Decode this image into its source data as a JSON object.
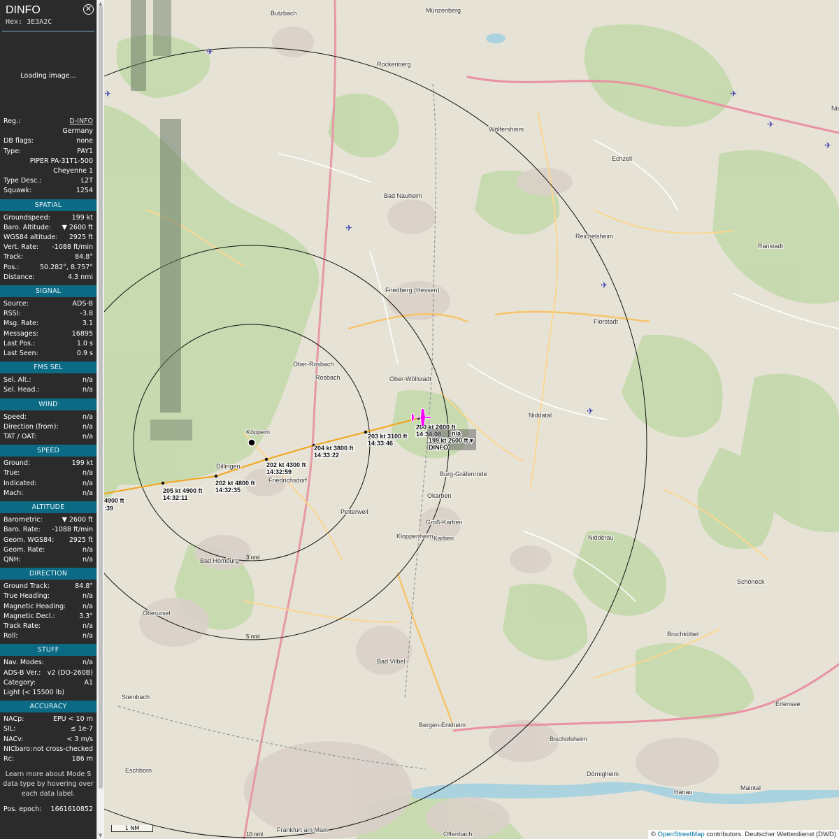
{
  "sidebar": {
    "callsign": "DINFO",
    "hex_label": "Hex:",
    "hex": "3E3A2C",
    "loading": "Loading image...",
    "general": [
      {
        "k": "Reg.:",
        "v": "D-INFO",
        "link": true
      },
      {
        "k": "",
        "v": "Germany"
      },
      {
        "k": "DB flags:",
        "v": "none"
      },
      {
        "k": "Type:",
        "v": "PAY1"
      },
      {
        "k": "",
        "v": "PIPER PA-31T1-500 Cheyenne 1"
      },
      {
        "k": "Type Desc.:",
        "v": "L2T"
      },
      {
        "k": "Squawk:",
        "v": "1254"
      }
    ],
    "sections": [
      {
        "title": "SPATIAL",
        "rows": [
          {
            "k": "Groundspeed:",
            "v": "199 kt"
          },
          {
            "k": "Baro. Altitude:",
            "v": "▼ 2600 ft"
          },
          {
            "k": "WGS84 altitude:",
            "v": "2925 ft"
          },
          {
            "k": "Vert. Rate:",
            "v": "-1088 ft/min"
          },
          {
            "k": "Track:",
            "v": "84.8°"
          },
          {
            "k": "Pos.:",
            "v": "50.282°, 8.757°"
          },
          {
            "k": "Distance:",
            "v": "4.3 nmi"
          }
        ]
      },
      {
        "title": "SIGNAL",
        "rows": [
          {
            "k": "Source:",
            "v": "ADS-B"
          },
          {
            "k": "RSSI:",
            "v": "-3.8"
          },
          {
            "k": "Msg. Rate:",
            "v": "3.1"
          },
          {
            "k": "Messages:",
            "v": "16895"
          },
          {
            "k": "Last Pos.:",
            "v": "1.0 s"
          },
          {
            "k": "Last Seen:",
            "v": "0.9 s"
          }
        ]
      },
      {
        "title": "FMS SEL",
        "rows": [
          {
            "k": "Sel. Alt.:",
            "v": "n/a"
          },
          {
            "k": "Sel. Head.:",
            "v": "n/a"
          }
        ]
      },
      {
        "title": "WIND",
        "rows": [
          {
            "k": "Speed:",
            "v": "n/a"
          },
          {
            "k": "Direction (from):",
            "v": "n/a"
          },
          {
            "k": "TAT / OAT:",
            "v": "n/a"
          }
        ]
      },
      {
        "title": "SPEED",
        "rows": [
          {
            "k": "Ground:",
            "v": "199 kt"
          },
          {
            "k": "True:",
            "v": "n/a"
          },
          {
            "k": "Indicated:",
            "v": "n/a"
          },
          {
            "k": "Mach:",
            "v": "n/a"
          }
        ]
      },
      {
        "title": "ALTITUDE",
        "rows": [
          {
            "k": "Barometric:",
            "v": "▼ 2600 ft"
          },
          {
            "k": "Baro. Rate:",
            "v": "-1088 ft/min"
          },
          {
            "k": "Geom. WGS84:",
            "v": "2925 ft"
          },
          {
            "k": "Geom. Rate:",
            "v": "n/a"
          },
          {
            "k": "QNH:",
            "v": "n/a"
          }
        ]
      },
      {
        "title": "DIRECTION",
        "rows": [
          {
            "k": "Ground Track:",
            "v": "84.8°"
          },
          {
            "k": "True Heading:",
            "v": "n/a"
          },
          {
            "k": "Magnetic Heading:",
            "v": "n/a"
          },
          {
            "k": "Magnetic Decl.:",
            "v": "3.3°"
          },
          {
            "k": "Track Rate:",
            "v": "n/a"
          },
          {
            "k": "Roll:",
            "v": "n/a"
          }
        ]
      },
      {
        "title": "STUFF",
        "rows": [
          {
            "k": "Nav. Modes:",
            "v": "n/a"
          },
          {
            "k": "ADS-B Ver.:",
            "v": "v2 (DO-260B)"
          },
          {
            "k": "Category:",
            "v": "A1"
          },
          {
            "k": "Light (< 15500 lb)",
            "v": ""
          }
        ]
      },
      {
        "title": "ACCURACY",
        "rows": [
          {
            "k": "NACp:",
            "v": "EPU < 10 m"
          },
          {
            "k": "SIL:",
            "v": "≤ 1e-7"
          },
          {
            "k": "NACv:",
            "v": "< 3 m/s"
          },
          {
            "k": "NICbaro:",
            "v": "not cross-checked"
          },
          {
            "k": "Rc:",
            "v": "186 m"
          }
        ]
      }
    ],
    "learn_more": "Learn more about Mode S data type by hovering over each data label.",
    "pos_epoch_label": "Pos. epoch:",
    "pos_epoch": "1661610852"
  },
  "map": {
    "attribution_prefix": "©",
    "attribution_link": "OpenStreetMap",
    "attribution_suffix": "contributors. Deutscher Wetterdienst (DWD)",
    "scale": "1 NM",
    "ring_labels": [
      "3 nmi",
      "5 nmi",
      "10 nmi"
    ],
    "places": [
      {
        "t": "Butzbach"
      },
      {
        "t": "Rockenberg"
      },
      {
        "t": "Münzenberg"
      },
      {
        "t": "Wölfersheim"
      },
      {
        "t": "Echzell"
      },
      {
        "t": "Bad Nauheim"
      },
      {
        "t": "Reichelsheim"
      },
      {
        "t": "Friedberg (Hessen)"
      },
      {
        "t": "Florstadt"
      },
      {
        "t": "Rosbach"
      },
      {
        "t": "Ober-Rosbach"
      },
      {
        "t": "Ober-Wöllstadt"
      },
      {
        "t": "Niddatal"
      },
      {
        "t": "Karben"
      },
      {
        "t": "Bad Homburg"
      },
      {
        "t": "Oberursel"
      },
      {
        "t": "Bad Vilbel"
      },
      {
        "t": "Nidderau"
      },
      {
        "t": "Bruchköbel"
      },
      {
        "t": "Frankfurt am Main"
      },
      {
        "t": "Offenbach"
      },
      {
        "t": "Bischofsheim"
      },
      {
        "t": "Hanau"
      },
      {
        "t": "Maintal"
      },
      {
        "t": "Schöneck"
      },
      {
        "t": "Ranstadt"
      },
      {
        "t": "Nidda"
      },
      {
        "t": "Köppern"
      },
      {
        "t": "Dillingen"
      },
      {
        "t": "Friedrichsdorf"
      },
      {
        "t": "Petterweil"
      },
      {
        "t": "Burg-Gräfenrode"
      },
      {
        "t": "Okarben"
      },
      {
        "t": "Groß-Karben"
      },
      {
        "t": "Kloppenheim"
      },
      {
        "t": "Steinbach"
      },
      {
        "t": "Eschborn"
      },
      {
        "t": "Bergen-Enkheim"
      },
      {
        "t": "Dörnigheim"
      },
      {
        "t": "Erlensee"
      }
    ],
    "track_labels": [
      {
        "spd": "205 kt",
        "alt": "4900 ft",
        "time": "14:32:11"
      },
      {
        "spd": "202 kt",
        "alt": "4800 ft",
        "time": "14:32:35"
      },
      {
        "spd": "202 kt",
        "alt": "4300 ft",
        "time": "14:32:59"
      },
      {
        "spd": "204 kt",
        "alt": "3800 ft",
        "time": "14:33:22"
      },
      {
        "spd": "203 kt",
        "alt": "3100 ft",
        "time": "14:33:46"
      },
      {
        "spd": "200 kt",
        "alt": "2600 ft",
        "time": "14:34:08"
      }
    ],
    "edge_track_label": {
      "alt": "4900 ft",
      "time": ":39"
    },
    "aircraft_label": {
      "line1": "199 kt  2600 ft ▾",
      "line2": "DINFO",
      "na": "n/a"
    },
    "colors": {
      "track_orange": "#f2a51a",
      "aircraft": "#ff00ff",
      "forest": "#add19e",
      "road": "#f7c46a"
    }
  }
}
